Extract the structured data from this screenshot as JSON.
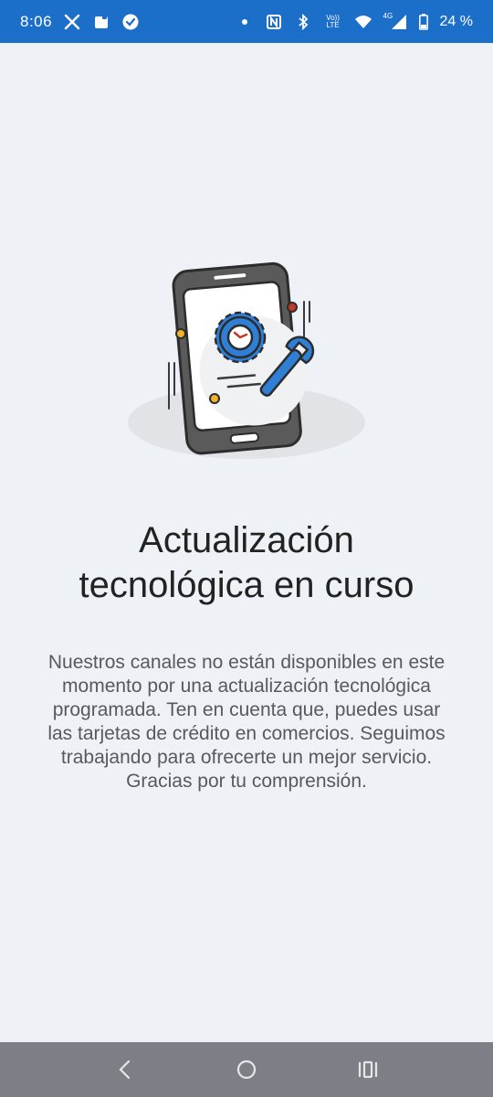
{
  "status_bar": {
    "time": "8:06",
    "battery": "24 %",
    "net_top": "Vo))",
    "net_bottom": "LTE",
    "net_4g": "4G",
    "left_icons": [
      "x-icon",
      "app-icon",
      "check-badge-icon"
    ],
    "right_icons": [
      "dot-icon",
      "nfc-icon",
      "bluetooth-icon",
      "volte-icon",
      "wifi-icon",
      "signal-icon",
      "battery-icon"
    ]
  },
  "illustration": {
    "name": "phone-maintenance-illustration",
    "accent": "#2f7fd6",
    "dark": "#3a3a3a"
  },
  "main": {
    "title_line1": "Actualización",
    "title_line2": "tecnológica en curso",
    "message": "Nuestros canales no están disponibles en este momento por una actualización tecnológica programada. Ten en cuenta que, puedes usar las tarjetas de crédito en comercios. Seguimos trabajando para ofrecerte un mejor servicio. Gracias por tu comprensión."
  },
  "nav_bar": {
    "buttons": [
      "back-icon",
      "home-icon",
      "recents-icon"
    ]
  },
  "colors": {
    "status_bar": "#1c6fc8",
    "background": "#eef2f6",
    "title": "#222222",
    "body": "#555a60",
    "nav_bar": "#7c7f85"
  }
}
